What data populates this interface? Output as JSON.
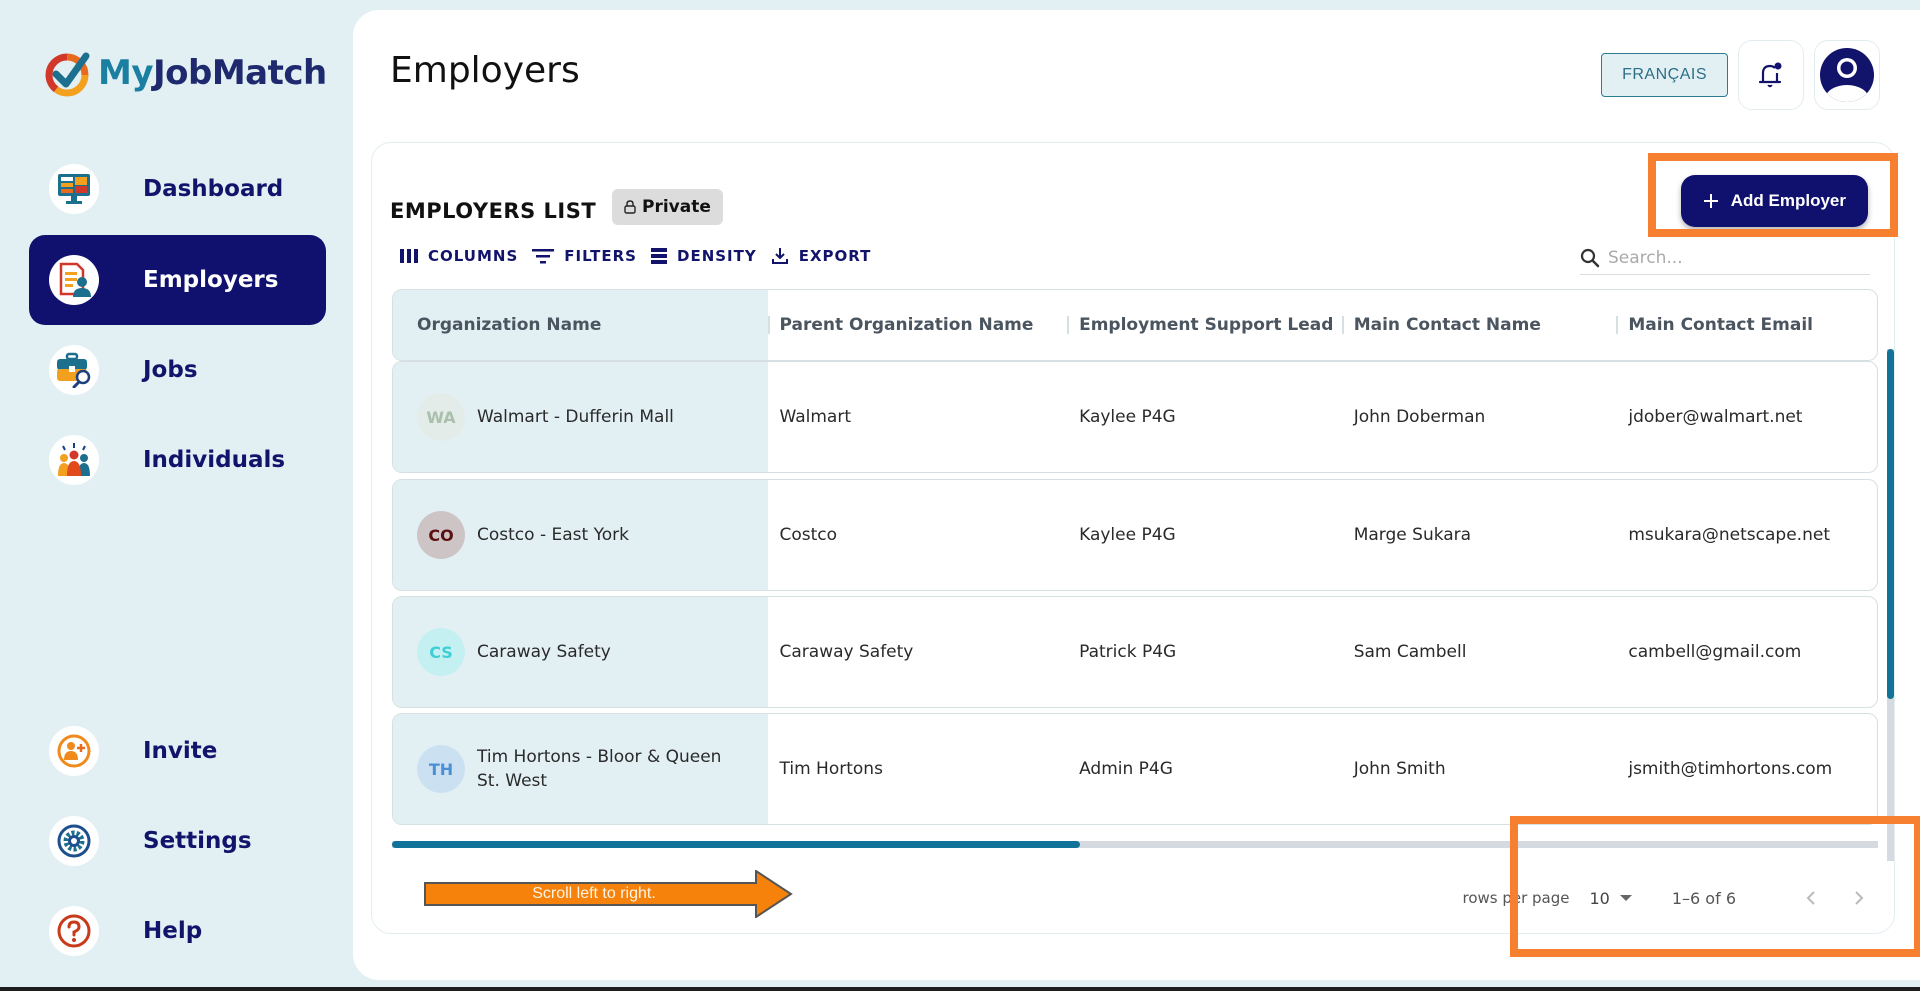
{
  "brand": {
    "name_part1": "My",
    "name_part2": "JobMatch"
  },
  "sidebar": {
    "items": [
      {
        "label": "Dashboard",
        "icon": "dashboard-icon",
        "active": false
      },
      {
        "label": "Employers",
        "icon": "employers-icon",
        "active": true
      },
      {
        "label": "Jobs",
        "icon": "jobs-icon",
        "active": false
      },
      {
        "label": "Individuals",
        "icon": "individuals-icon",
        "active": false
      }
    ],
    "bottom_items": [
      {
        "label": "Invite",
        "icon": "invite-icon"
      },
      {
        "label": "Settings",
        "icon": "settings-icon"
      },
      {
        "label": "Help",
        "icon": "help-icon"
      }
    ]
  },
  "header": {
    "title": "Employers",
    "language_button": "FRANÇAIS",
    "notification_icon": "bell-icon",
    "profile_icon": "account-icon"
  },
  "list": {
    "title": "EMPLOYERS LIST",
    "visibility_badge": "Private",
    "add_button": "Add Employer",
    "toolbar": {
      "columns": "COLUMNS",
      "filters": "FILTERS",
      "density": "DENSITY",
      "export": "EXPORT"
    },
    "search_placeholder": "Search...",
    "columns": [
      "Organization Name",
      "Parent Organization Name",
      "Employment Support Lead",
      "Main Contact Name",
      "Main Contact Email"
    ],
    "rows": [
      {
        "initials": "WA",
        "avatar_bg": "#e3ece8",
        "avatar_fg": "#a9c0ac",
        "org": "Walmart - Dufferin Mall",
        "parent": "Walmart",
        "lead": "Kaylee P4G",
        "contact": "John Doberman",
        "email": "jdober@walmart.net"
      },
      {
        "initials": "CO",
        "avatar_bg": "#cdc4c6",
        "avatar_fg": "#5a1010",
        "org": "Costco - East York",
        "parent": "Costco",
        "lead": "Kaylee P4G",
        "contact": "Marge Sukara",
        "email": "msukara@netscape.net"
      },
      {
        "initials": "CS",
        "avatar_bg": "#c4f0f2",
        "avatar_fg": "#3ecfd6",
        "org": "Caraway Safety",
        "parent": "Caraway Safety",
        "lead": "Patrick P4G",
        "contact": "Sam Cambell",
        "email": "cambell@gmail.com"
      },
      {
        "initials": "TH",
        "avatar_bg": "#cbe1f2",
        "avatar_fg": "#4b8fd6",
        "org": "Tim Hortons - Bloor & Queen St. West",
        "parent": "Tim Hortons",
        "lead": "Admin P4G",
        "contact": "John Smith",
        "email": "jsmith@timhortons.com"
      }
    ],
    "pagination": {
      "rows_per_page_label": "rows per page",
      "rows_per_page": "10",
      "range": "1–6 of 6"
    },
    "annotation": "Scroll left to right."
  },
  "colors": {
    "brand_navy": "#10116e",
    "accent_teal": "#117399",
    "highlight_orange": "#f68030",
    "sidebar_bg": "#e2f0f4"
  }
}
